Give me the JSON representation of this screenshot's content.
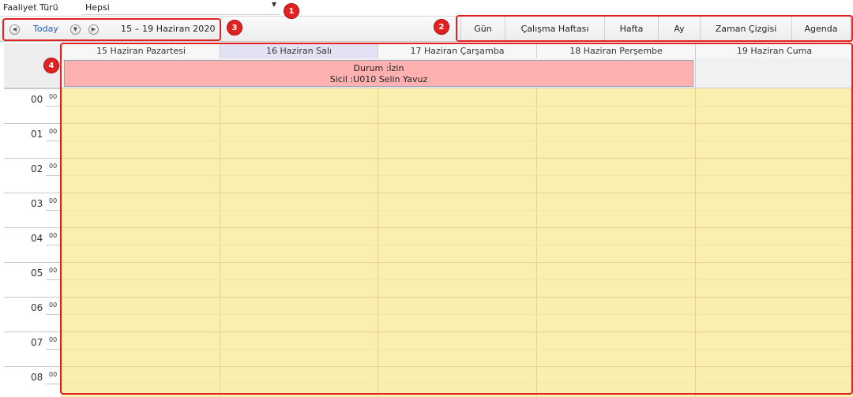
{
  "filter": {
    "label": "Faaliyet Türü",
    "value": "Hepsi",
    "caret_icon": "▼"
  },
  "toolbar": {
    "prev_icon": "◀",
    "today_label": "Today",
    "dropdown_icon": "▼",
    "next_icon": "▶",
    "date_range": "15 – 19 Haziran 2020"
  },
  "views": [
    {
      "label": "Gün"
    },
    {
      "label": "Çalışma Haftası"
    },
    {
      "label": "Hafta"
    },
    {
      "label": "Ay"
    },
    {
      "label": "Zaman Çizgisi"
    },
    {
      "label": "Agenda"
    }
  ],
  "days": [
    {
      "label": "15 Haziran Pazartesi"
    },
    {
      "label": "16 Haziran Salı"
    },
    {
      "label": "17 Haziran Çarşamba"
    },
    {
      "label": "18 Haziran Perşembe"
    },
    {
      "label": "19 Haziran Cuma"
    }
  ],
  "allday_event": {
    "line1": "Durum :İzin",
    "line2": "Sicil :U010 Selin Yavuz"
  },
  "hours": [
    {
      "hour": "00",
      "minute": "00"
    },
    {
      "hour": "01",
      "minute": "00"
    },
    {
      "hour": "02",
      "minute": "00"
    },
    {
      "hour": "03",
      "minute": "00"
    },
    {
      "hour": "04",
      "minute": "00"
    },
    {
      "hour": "05",
      "minute": "00"
    },
    {
      "hour": "06",
      "minute": "00"
    },
    {
      "hour": "07",
      "minute": "00"
    },
    {
      "hour": "08",
      "minute": "00"
    }
  ],
  "callouts": [
    "1",
    "2",
    "3",
    "4"
  ],
  "colors": {
    "callout": "#e02222",
    "slot_background": "#fbefb0",
    "event_background": "#ffb0b0",
    "today_header": "#e3e1f4",
    "today_link": "#1d5fb4"
  }
}
